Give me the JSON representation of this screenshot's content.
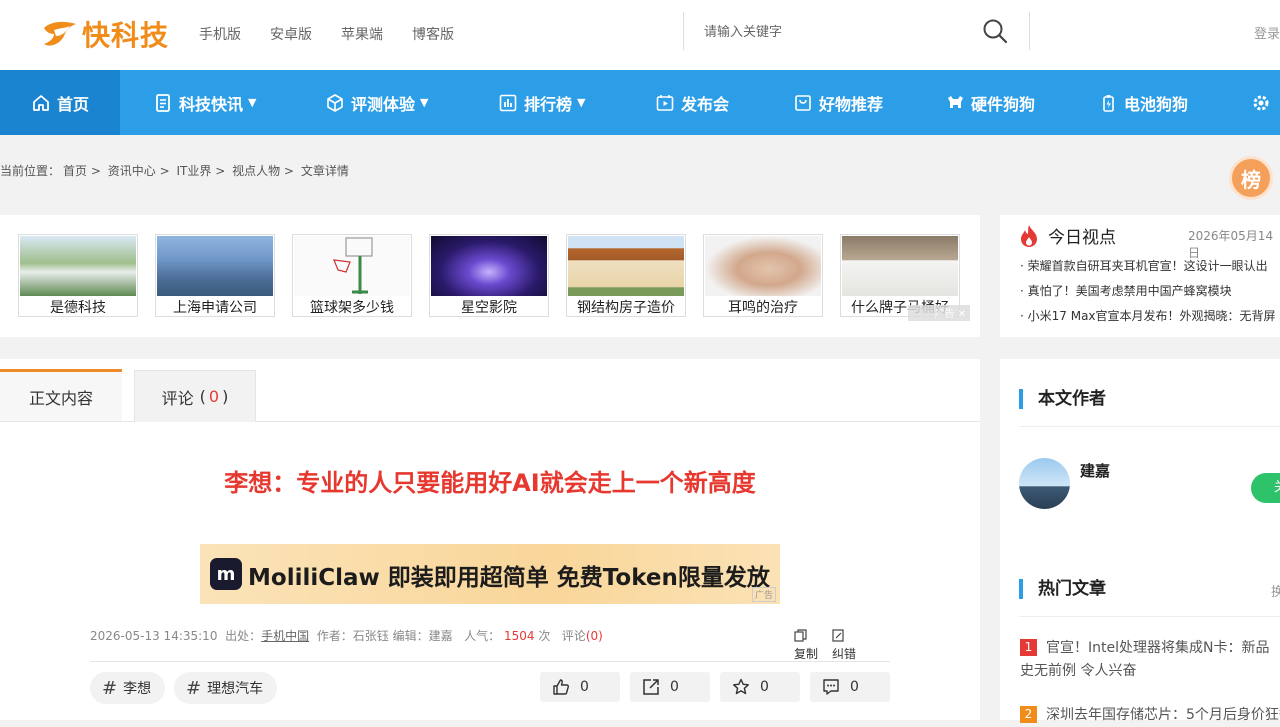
{
  "header": {
    "logo_text": "快科技",
    "nav_links": [
      "手机版",
      "安卓版",
      "苹果端",
      "博客版"
    ],
    "search_placeholder": "请输入关键字",
    "login_label": "登录"
  },
  "main_nav": [
    {
      "label": "首页",
      "icon": "home-icon",
      "active": true,
      "dropdown": false
    },
    {
      "label": "科技快讯",
      "icon": "document-icon",
      "active": false,
      "dropdown": true
    },
    {
      "label": "评测体验",
      "icon": "cube-icon",
      "active": false,
      "dropdown": true
    },
    {
      "label": "排行榜",
      "icon": "bar-chart-icon",
      "active": false,
      "dropdown": true
    },
    {
      "label": "发布会",
      "icon": "video-icon",
      "active": false,
      "dropdown": false
    },
    {
      "label": "好物推荐",
      "icon": "shopping-bag-icon",
      "active": false,
      "dropdown": false
    },
    {
      "label": "硬件狗狗",
      "icon": "dog-icon",
      "active": false,
      "dropdown": false
    },
    {
      "label": "电池狗狗",
      "icon": "battery-dog-icon",
      "active": false,
      "dropdown": false
    }
  ],
  "breadcrumb": [
    "当前位置：",
    "首页",
    ">",
    "资讯中心",
    ">",
    "IT业界",
    ">",
    "视点人物",
    ">",
    "文章详情"
  ],
  "rank_badge": "榜",
  "ad_cards": [
    {
      "caption": "是德科技",
      "color": "#6d9a60"
    },
    {
      "caption": "上海申请公司",
      "color": "#5d86b8"
    },
    {
      "caption": "篮球架多少钱",
      "color": "#d8d8d8"
    },
    {
      "caption": "星空影院",
      "color": "#3a2a8a"
    },
    {
      "caption": "钢结构房子造价",
      "color": "#c98a4a"
    },
    {
      "caption": "耳鸣的治疗",
      "color": "#c9b09c"
    },
    {
      "caption": "什么牌子马桶好",
      "color": "#b8a892"
    }
  ],
  "ad_label": "广告",
  "today": {
    "title": "今日视点",
    "date": "2026年05月14日",
    "items": [
      "· 荣耀首款自研耳夹耳机官宣！这设计一眼认出",
      "· 真怕了！美国考虑禁用中国产蜂窝模块",
      "· 小米17 Max官宣本月发布！外观揭晓：无背屏"
    ]
  },
  "article": {
    "tabs": {
      "content": "正文内容",
      "comments": "评论",
      "comment_count": "0"
    },
    "title": "李想：专业的人只要能用好AI就会走上一个新高度",
    "banner": {
      "logo": "m",
      "text": "MoliliClaw 即装即用超简单 免费Token限量发放",
      "ad": "广告"
    },
    "meta": {
      "datetime": "2026-05-13 14:35:10",
      "source_label": "出处：",
      "source": "手机中国",
      "author_label": "作者：",
      "author": "石张钰",
      "editor_label": "编辑：",
      "editor": "建嘉",
      "views_label": "人气：",
      "views": "1504",
      "views_unit": "次",
      "comments_label": "评论",
      "comments": "(0)"
    },
    "actions": {
      "copy": "复制",
      "report": "纠错"
    },
    "tags": [
      "李想",
      "理想汽车"
    ],
    "reactions": [
      {
        "icon": "thumbs-up-icon",
        "count": "0"
      },
      {
        "icon": "share-icon",
        "count": "0"
      },
      {
        "icon": "star-icon",
        "count": "0"
      },
      {
        "icon": "comment-icon",
        "count": "0"
      }
    ]
  },
  "sidebar": {
    "author_section": "本文作者",
    "author_name": "建嘉",
    "follow_label": "关",
    "hot_section": "热门文章",
    "hot_swap": "换",
    "hot_items": [
      {
        "rank": "1",
        "color": "#e53935",
        "text": "官宣！Intel处理器将集成N卡：新品史无前例 令人兴奋"
      },
      {
        "rank": "2",
        "color": "#f08c1a",
        "text": "深圳去年国存储芯片：5个月后身价狂翻"
      }
    ]
  },
  "colors": {
    "accent_blue": "#2c9ee8",
    "title_red": "#e6382f",
    "orange": "#f08c1a"
  }
}
